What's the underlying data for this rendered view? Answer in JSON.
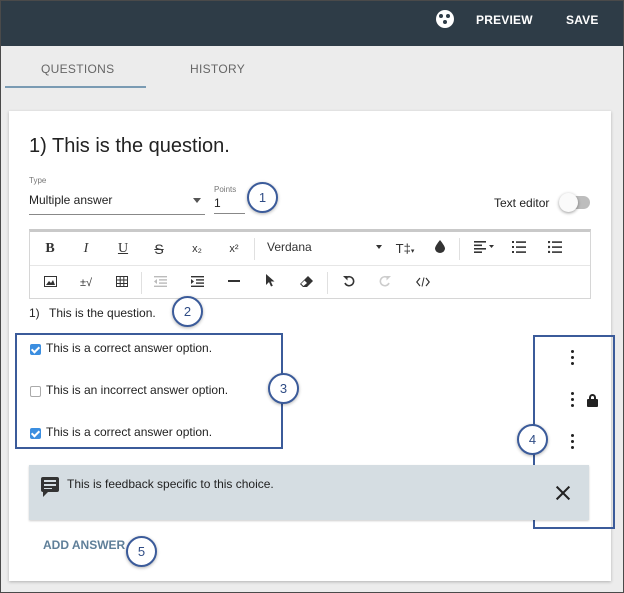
{
  "topbar": {
    "icon": "palette-icon",
    "preview_label": "PREVIEW",
    "save_label": "SAVE",
    "bg_color": "#2e3c47"
  },
  "tabs": [
    {
      "label": "QUESTIONS",
      "active": true
    },
    {
      "label": "HISTORY",
      "active": false
    }
  ],
  "question": {
    "title": "1) This is the question.",
    "type_label": "Type",
    "type_value": "Multiple answer",
    "points_label": "Points",
    "points_value": "1",
    "text_editor_label": "Text editor",
    "text_editor_on": false
  },
  "editor_toolbar": {
    "row1": [
      "B",
      "I",
      "U",
      "S",
      "x₂",
      "x²"
    ],
    "font_value": "Verdana",
    "text_size_glyph": "T‡",
    "row2_misc": [
      "±√"
    ]
  },
  "editor_content": {
    "number": "1)",
    "text": "This is the question."
  },
  "answers": [
    {
      "text": "This is a correct answer option.",
      "checked": true
    },
    {
      "text": "This is an incorrect answer option.",
      "checked": false
    },
    {
      "text": "This is a correct answer option.",
      "checked": true
    }
  ],
  "feedback": {
    "icon": "comment-icon",
    "text": "This is feedback specific to this choice."
  },
  "add_answer_label": "ADD ANSWER",
  "callouts": [
    "1",
    "2",
    "3",
    "4",
    "5"
  ],
  "colors": {
    "callout_border": "#3b5b9a",
    "checkbox_checked": "#3b8ee0",
    "feedback_bg": "#d5dde2",
    "add_answer": "#5f7f99"
  }
}
